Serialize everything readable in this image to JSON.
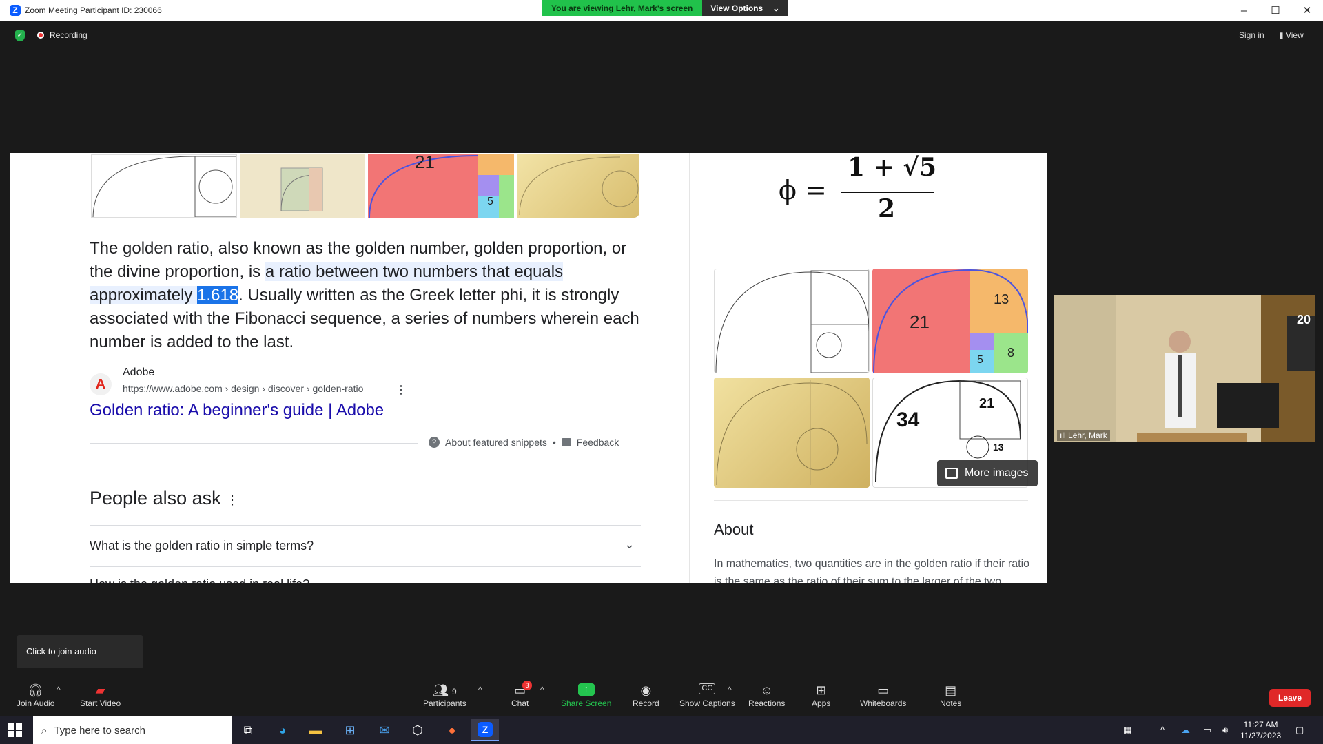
{
  "window": {
    "title": "Zoom Meeting Participant ID: 230066",
    "minimize": "–",
    "maximize": "☐",
    "close": "✕"
  },
  "banner": {
    "viewing": "You are viewing Lehr, Mark's screen",
    "view_options": "View Options"
  },
  "meeting_bar": {
    "recording": "Recording",
    "sign_in": "Sign in",
    "view": "View"
  },
  "shared": {
    "snippet": {
      "part1": "The golden ratio, also known as the golden number, golden proportion, or the divine proportion, is ",
      "highlight": "a ratio between two numbers that equals approximately ",
      "value": "1.618",
      "part2": ". Usually written as the Greek letter phi, it is strongly associated with the Fibonacci sequence, a series of numbers wherein each number is added to the last."
    },
    "source": {
      "name": "Adobe",
      "logo": "A",
      "url": "https://www.adobe.com › design › discover › golden-ratio",
      "link": "Golden ratio: A beginner's guide | Adobe"
    },
    "footer": {
      "about": "About featured snippets",
      "dot": "•",
      "feedback": "Feedback"
    },
    "paa": {
      "title": "People also ask",
      "q1": "What is the golden ratio in simple terms?",
      "q2": "How is the golden ratio used in real life?"
    },
    "thumb_numbers": {
      "n21": "21",
      "n5": "5"
    },
    "formula": {
      "phi": "ϕ =",
      "numerator": "1 + √5",
      "denominator": "2"
    },
    "images": {
      "n21": "21",
      "n13": "13",
      "n8": "8",
      "n5": "5",
      "n34": "34",
      "n21b": "21",
      "n13b": "13",
      "more": "More images"
    },
    "about": {
      "title": "About",
      "text": "In mathematics, two quantities are in the golden ratio if their ratio is the same as the ratio of their sum to the larger of the two quantities."
    }
  },
  "video": {
    "name": "Lehr, Mark",
    "signal": "ıll",
    "sign": "20"
  },
  "tooltip": "Click to join audio",
  "toolbar": {
    "join_audio": "Join Audio",
    "start_video": "Start Video",
    "participants": "Participants",
    "participants_count": "9",
    "chat": "Chat",
    "chat_badge": "3",
    "share_screen": "Share Screen",
    "record": "Record",
    "show_captions": "Show Captions",
    "reactions": "Reactions",
    "apps": "Apps",
    "whiteboards": "Whiteboards",
    "notes": "Notes",
    "leave": "Leave"
  },
  "taskbar": {
    "search_placeholder": "Type here to search",
    "time": "11:27 AM",
    "date": "11/27/2023"
  },
  "colors": {
    "zoom_blue": "#0b5cff",
    "banner_green": "#21c24b",
    "leave_red": "#e02828",
    "link_blue": "#1a0dab",
    "highlight": "#1a73e8"
  }
}
